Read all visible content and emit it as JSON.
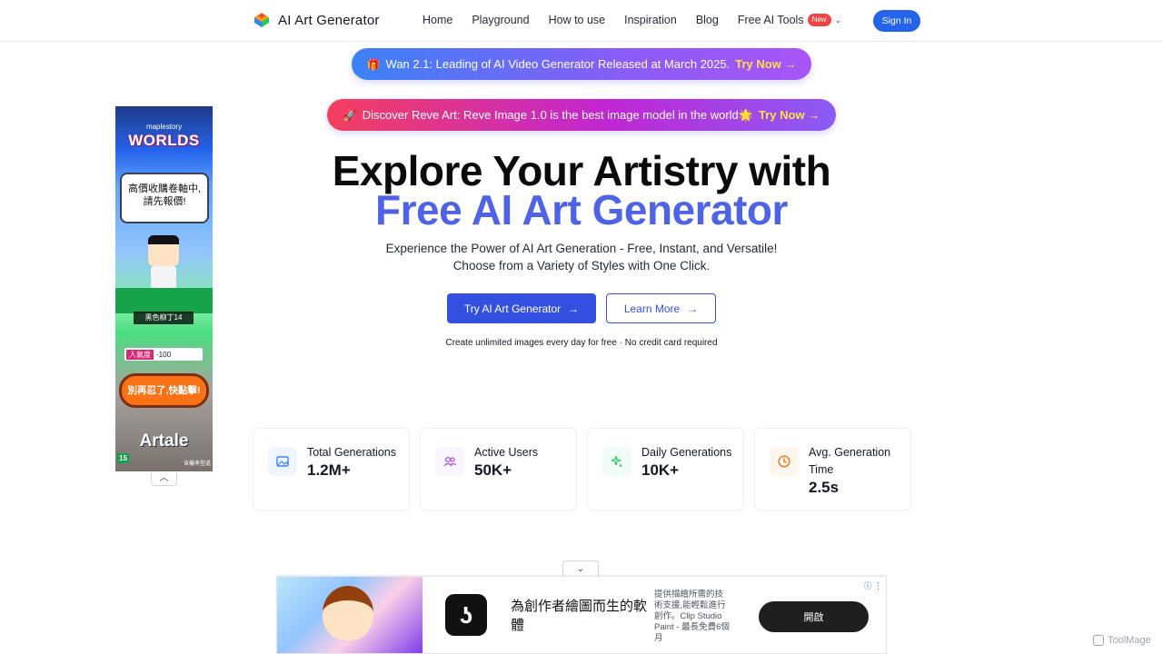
{
  "header": {
    "logo_text": "AI Art Generator",
    "nav": [
      "Home",
      "Playground",
      "How to use",
      "Inspiration",
      "Blog"
    ],
    "tools_label": "Free AI Tools",
    "new_badge": "New",
    "sign_in": "Sign In"
  },
  "banners": [
    {
      "emoji": "🎁",
      "text": "Wan 2.1: Leading of AI Video Generator Released at March 2025.",
      "cta": "Try Now →"
    },
    {
      "emoji": "🚀",
      "text": "Discover Reve Art: Reve Image 1.0 is the best image model in the world🌟",
      "cta": "Try Now →"
    }
  ],
  "hero": {
    "title_line1": "Explore Your Artistry with",
    "title_line2": "Free AI Art Generator",
    "subtitle_line1": "Experience the Power of AI Art Generation - Free, Instant, and Versatile!",
    "subtitle_line2": "Choose from a Variety of Styles with One Click.",
    "primary_button": "Try AI Art Generator",
    "secondary_button": "Learn More",
    "note": "Create unlimited images every day for free · No credit card required"
  },
  "stats": [
    {
      "label": "Total Generations",
      "value": "1.2M+",
      "icon": "image-icon",
      "color": "#3b82f6"
    },
    {
      "label": "Active Users",
      "value": "50K+",
      "icon": "users-icon",
      "color": "#a855f7"
    },
    {
      "label": "Daily Generations",
      "value": "10K+",
      "icon": "sparkles-icon",
      "color": "#22c55e"
    },
    {
      "label": "Avg. Generation Time",
      "value": "2.5s",
      "icon": "clock-icon",
      "color": "#f97316"
    }
  ],
  "left_ad": {
    "brand_small": "maplestory",
    "brand_big": "WORLDS",
    "bubble_line1": "高價收購卷軸中,",
    "bubble_line2": "請先報價!",
    "name_tag": "黑色柳丁14",
    "stat_label": "人氣度",
    "stat_value": "-100",
    "cta": "別再忍了,快點擊!",
    "logo": "Artale",
    "age": "15",
    "footnote": "含機率型道"
  },
  "bottom_ad": {
    "headline": "為創作者繪圖而生的軟體",
    "description": "提供描繪所需的技術支援,能輕鬆進行創作。Clip Studio Paint - 最長免費6個月",
    "button": "開啟"
  },
  "watermark": "ToolMage"
}
